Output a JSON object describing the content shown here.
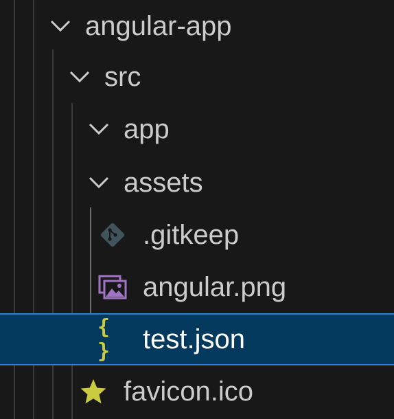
{
  "explorer": {
    "items": [
      {
        "label": "angular-app",
        "kind": "folder",
        "expanded": true,
        "icon": "chevron-down-icon"
      },
      {
        "label": "src",
        "kind": "folder",
        "expanded": true,
        "icon": "chevron-down-icon"
      },
      {
        "label": "app",
        "kind": "folder",
        "expanded": true,
        "icon": "chevron-down-icon"
      },
      {
        "label": "assets",
        "kind": "folder",
        "expanded": true,
        "icon": "chevron-down-icon"
      },
      {
        "label": ".gitkeep",
        "kind": "file",
        "icon": "git-icon",
        "icon_color": "#41535b"
      },
      {
        "label": "angular.png",
        "kind": "file",
        "icon": "image-icon",
        "icon_color": "#a074c4"
      },
      {
        "label": "test.json",
        "kind": "file",
        "icon": "json-icon",
        "icon_glyph": "{ }",
        "icon_color": "#cbcb41",
        "selected": true
      },
      {
        "label": "favicon.ico",
        "kind": "file",
        "icon": "star-icon",
        "icon_color": "#cbcb41"
      }
    ]
  },
  "colors": {
    "background": "#181818",
    "selection_background": "#04395e",
    "selection_border": "#2c82d3",
    "text": "#cccccc",
    "selected_text": "#ffffff",
    "indent_guide": "#3a3a3a",
    "active_indent_guide": "#6b6b6b"
  }
}
